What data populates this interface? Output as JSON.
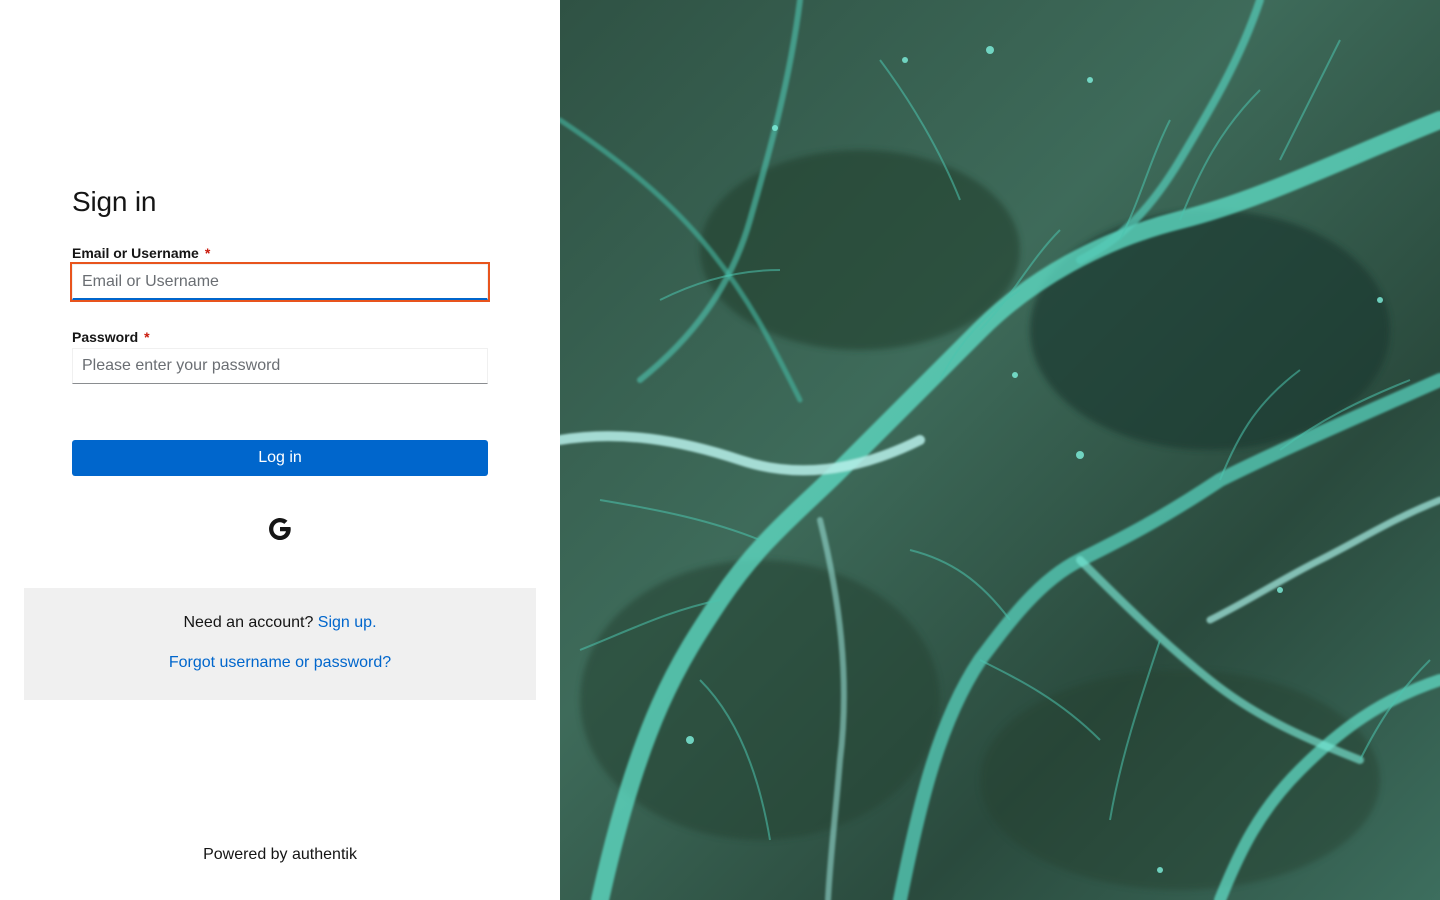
{
  "login": {
    "title": "Sign in",
    "username_label": "Email or Username",
    "username_placeholder": "Email or Username",
    "password_label": "Password",
    "password_placeholder": "Please enter your password",
    "required_marker": "*",
    "submit_label": "Log in",
    "source_icon": "google-icon"
  },
  "footer": {
    "signup_prompt": "Need an account?",
    "signup_link": "Sign up.",
    "forgot_link": "Forgot username or password?"
  },
  "branding": {
    "powered_by": "Powered by authentik"
  },
  "colors": {
    "primary": "#0066cc",
    "focus_outline": "#e8541d",
    "required": "#c9190b",
    "footer_bg": "#f0f0f0"
  }
}
